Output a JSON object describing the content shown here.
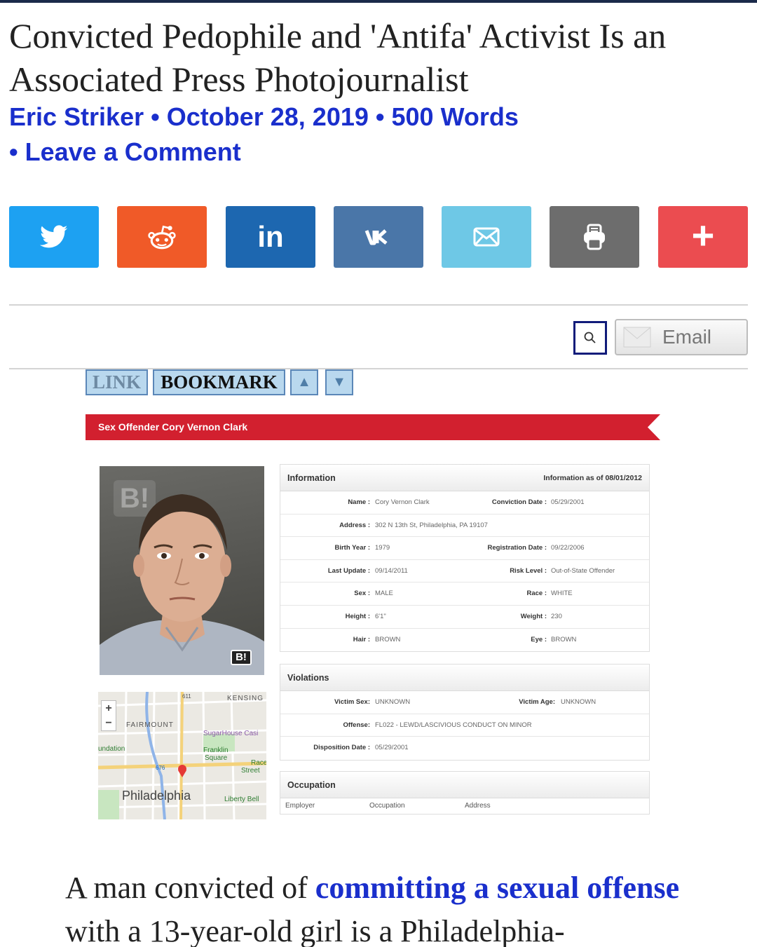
{
  "article": {
    "title": "Convicted Pedophile and 'Antifa' Activist Is an Associated Press Photojournalist",
    "byline": {
      "author": "Eric Striker",
      "sep1": " • ",
      "date": "October 28, 2019",
      "sep2": " • ",
      "words": "500 Words",
      "sep3": "• ",
      "comment": "Leave a Comment"
    },
    "body": {
      "text1": "A man convicted of ",
      "link": "committing a sexual offense",
      "text2": " with a 13-year-old girl is a Philadelphia-"
    }
  },
  "share": {
    "buttons": [
      {
        "name": "twitter",
        "icon": "twitter-bird-icon",
        "color": "#1da1f2"
      },
      {
        "name": "reddit",
        "icon": "reddit-alien-icon",
        "color": "#ff4500"
      },
      {
        "name": "linkedin",
        "icon": "linkedin-icon",
        "label": "in",
        "color": "#1d67b0"
      },
      {
        "name": "vk",
        "icon": "vk-icon",
        "label": "vk",
        "color": "#4a76a8"
      },
      {
        "name": "email",
        "icon": "envelope-icon",
        "color": "#6ec8e6"
      },
      {
        "name": "print",
        "icon": "printer-icon",
        "color": "#6d6d6d"
      },
      {
        "name": "more",
        "icon": "plus-icon",
        "label": "+",
        "color": "#eb4c50"
      }
    ]
  },
  "toolbar": {
    "search_icon": "magnifier-icon",
    "email_label": "Email"
  },
  "embedded_image": {
    "nav": {
      "link": "LINK",
      "bookmark": "BOOKMARK",
      "up": "▲",
      "down": "▼"
    },
    "banner": "Sex Offender Cory Vernon Clark",
    "mugshot_watermark": "B!",
    "map": {
      "labels": [
        "KENSING",
        "FAIRMOUNT",
        "SugarHouse Casi",
        "undation",
        "Franklin",
        "Square",
        "Race",
        "Street",
        "Philadelphia",
        "Liberty Bell",
        "611",
        "676"
      ]
    },
    "information": {
      "heading": "Information",
      "as_of": "Information as of 08/01/2012",
      "rows": [
        [
          {
            "k": "Name :",
            "v": "Cory Vernon Clark"
          },
          {
            "k": "Conviction Date :",
            "v": "05/29/2001"
          }
        ],
        [
          {
            "k": "Address :",
            "v": "302 N 13th St, Philadelphia, PA 19107"
          }
        ],
        [
          {
            "k": "Birth Year :",
            "v": "1979"
          },
          {
            "k": "Registration Date :",
            "v": "09/22/2006"
          }
        ],
        [
          {
            "k": "Last Update :",
            "v": "09/14/2011"
          },
          {
            "k": "Risk Level :",
            "v": "Out-of-State Offender"
          }
        ],
        [
          {
            "k": "Sex :",
            "v": "MALE"
          },
          {
            "k": "Race :",
            "v": "WHITE"
          }
        ],
        [
          {
            "k": "Height :",
            "v": "6'1\""
          },
          {
            "k": "Weight :",
            "v": "230"
          }
        ],
        [
          {
            "k": "Hair :",
            "v": "BROWN"
          },
          {
            "k": "Eye :",
            "v": "BROWN"
          }
        ]
      ]
    },
    "violations": {
      "heading": "Violations",
      "rows": [
        [
          {
            "k": "Victim Sex:",
            "v": "UNKNOWN"
          },
          {
            "k": "Victim Age:",
            "v": "UNKNOWN"
          }
        ],
        [
          {
            "k": "Offense:",
            "v": "FL022 - LEWD/LASCIVIOUS CONDUCT ON MINOR"
          }
        ],
        [
          {
            "k": "Disposition Date :",
            "v": "05/29/2001"
          }
        ]
      ]
    },
    "occupation": {
      "heading": "Occupation",
      "columns": [
        "Employer",
        "Occupation",
        "Address"
      ]
    }
  }
}
